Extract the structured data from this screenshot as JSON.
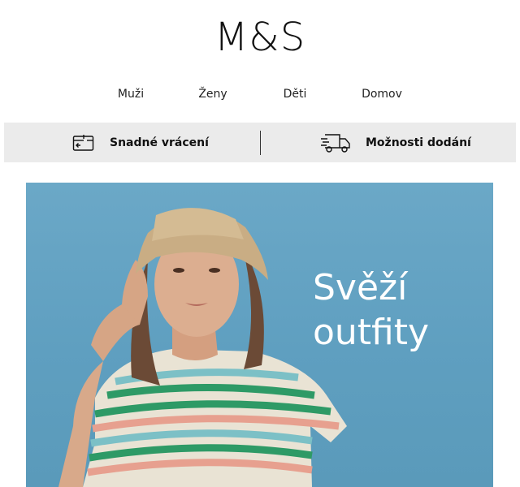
{
  "brand": {
    "logo": "M&S"
  },
  "nav": {
    "items": [
      "Muži",
      "Ženy",
      "Děti",
      "Domov"
    ]
  },
  "info_strip": {
    "returns": {
      "label": "Snadné vrácení",
      "icon": "return-package-icon"
    },
    "delivery": {
      "label": "Možnosti dodání",
      "icon": "delivery-truck-icon"
    }
  },
  "hero": {
    "headline_line1": "Svěží",
    "headline_line2": "outfity",
    "background_color": "#5f9fc0"
  }
}
